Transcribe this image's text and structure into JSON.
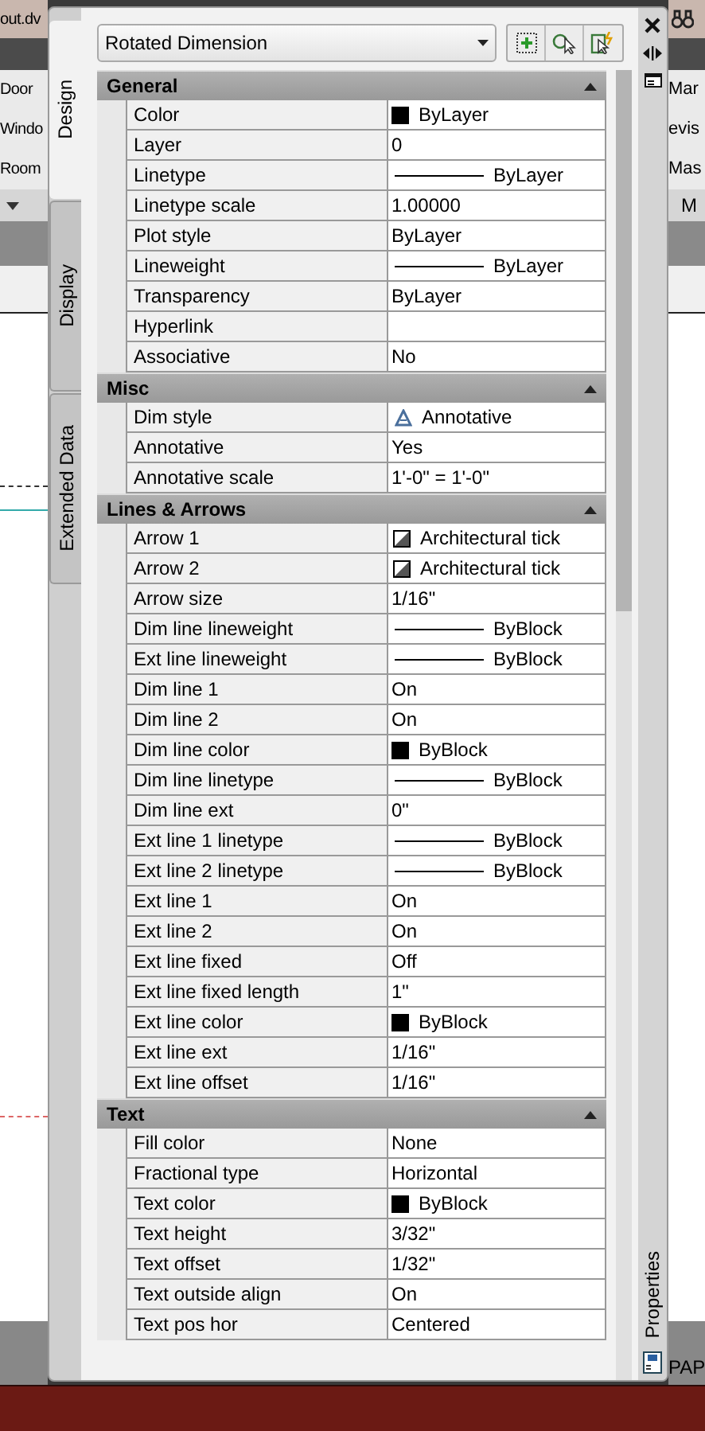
{
  "background_app": {
    "left_texts": [
      "out.dv",
      "Door",
      "Windo",
      "Room"
    ],
    "right_texts": [
      "Mar",
      "evis",
      "Mas",
      "M"
    ],
    "status_text": "PAP"
  },
  "palette": {
    "title": "Properties",
    "tabs": [
      {
        "label": "Design",
        "selected": true
      },
      {
        "label": "Display",
        "selected": false
      },
      {
        "label": "Extended Data",
        "selected": false
      }
    ],
    "object_type": "Rotated Dimension",
    "sections": [
      {
        "title": "General",
        "expanded": true,
        "rows": [
          {
            "label": "Color",
            "value": "ByLayer",
            "kind": "swatch"
          },
          {
            "label": "Layer",
            "value": "0",
            "kind": "text"
          },
          {
            "label": "Linetype",
            "value": "ByLayer",
            "kind": "line"
          },
          {
            "label": "Linetype scale",
            "value": "1.00000",
            "kind": "text"
          },
          {
            "label": "Plot style",
            "value": "ByLayer",
            "kind": "text"
          },
          {
            "label": "Lineweight",
            "value": "ByLayer",
            "kind": "line"
          },
          {
            "label": "Transparency",
            "value": "ByLayer",
            "kind": "text"
          },
          {
            "label": "Hyperlink",
            "kind": "text"
          },
          {
            "label": "Associative",
            "value": "No",
            "kind": "text"
          }
        ]
      },
      {
        "title": "Misc",
        "expanded": true,
        "rows": [
          {
            "label": "Dim style",
            "value": "Annotative",
            "kind": "style"
          },
          {
            "label": "Annotative",
            "value": "Yes",
            "kind": "text"
          },
          {
            "label": "Annotative scale",
            "value": "1'-0\" = 1'-0\"",
            "kind": "text"
          }
        ]
      },
      {
        "title": "Lines & Arrows",
        "expanded": true,
        "rows": [
          {
            "label": "Arrow 1",
            "value": "Architectural tick",
            "kind": "arrow"
          },
          {
            "label": "Arrow 2",
            "value": "Architectural tick",
            "kind": "arrow"
          },
          {
            "label": "Arrow size",
            "value": "1/16\"",
            "kind": "text"
          },
          {
            "label": "Dim line lineweight",
            "value": "ByBlock",
            "kind": "line"
          },
          {
            "label": "Ext line lineweight",
            "value": "ByBlock",
            "kind": "line"
          },
          {
            "label": "Dim line 1",
            "value": "On",
            "kind": "text"
          },
          {
            "label": "Dim line 2",
            "value": "On",
            "kind": "text"
          },
          {
            "label": "Dim line color",
            "value": "ByBlock",
            "kind": "swatch"
          },
          {
            "label": "Dim line linetype",
            "value": "ByBlock",
            "kind": "line"
          },
          {
            "label": "Dim line ext",
            "value": "0\"",
            "kind": "text"
          },
          {
            "label": "Ext line 1 linetype",
            "value": "ByBlock",
            "kind": "line"
          },
          {
            "label": "Ext line 2 linetype",
            "value": "ByBlock",
            "kind": "line"
          },
          {
            "label": "Ext line 1",
            "value": "On",
            "kind": "text"
          },
          {
            "label": "Ext line 2",
            "value": "On",
            "kind": "text"
          },
          {
            "label": "Ext line fixed",
            "value": "Off",
            "kind": "text"
          },
          {
            "label": "Ext line fixed length",
            "value": "1\"",
            "kind": "text"
          },
          {
            "label": "Ext line color",
            "value": "ByBlock",
            "kind": "swatch"
          },
          {
            "label": "Ext line ext",
            "value": "1/16\"",
            "kind": "text"
          },
          {
            "label": "Ext line offset",
            "value": "1/16\"",
            "kind": "text"
          }
        ]
      },
      {
        "title": "Text",
        "expanded": true,
        "rows": [
          {
            "label": "Fill color",
            "value": "None",
            "kind": "text"
          },
          {
            "label": "Fractional type",
            "value": "Horizontal",
            "kind": "text"
          },
          {
            "label": "Text color",
            "value": "ByBlock",
            "kind": "swatch"
          },
          {
            "label": "Text height",
            "value": "3/32\"",
            "kind": "text"
          },
          {
            "label": "Text offset",
            "value": "1/32\"",
            "kind": "text"
          },
          {
            "label": "Text outside align",
            "value": "On",
            "kind": "text"
          },
          {
            "label": "Text pos hor",
            "value": "Centered",
            "kind": "text"
          }
        ]
      }
    ]
  }
}
